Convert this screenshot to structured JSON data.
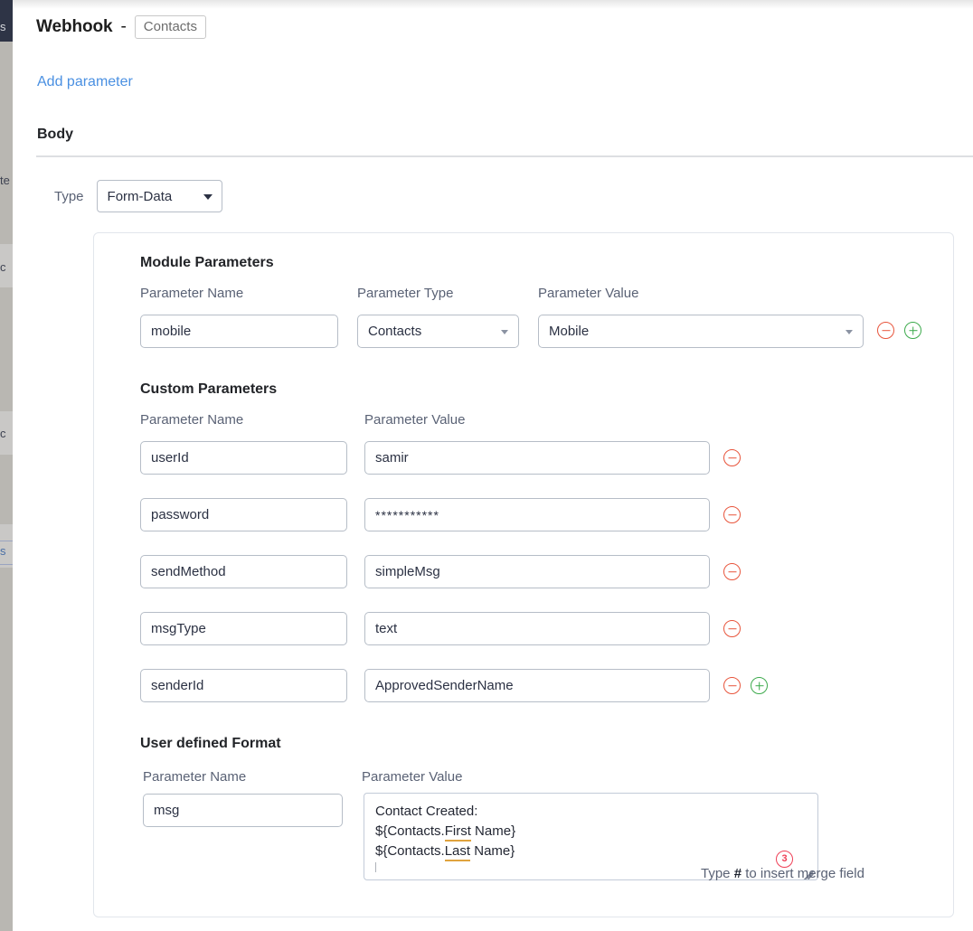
{
  "header": {
    "title": "Webhook",
    "separator": "-",
    "module_badge": "Contacts",
    "add_parameter_label": "Add parameter"
  },
  "body_section": {
    "heading": "Body",
    "type_label": "Type",
    "type_value": "Form-Data"
  },
  "module_parameters": {
    "title": "Module Parameters",
    "columns": {
      "name": "Parameter Name",
      "type": "Parameter Type",
      "value": "Parameter Value"
    },
    "rows": [
      {
        "name": "mobile",
        "type": "Contacts",
        "value": "Mobile"
      }
    ]
  },
  "custom_parameters": {
    "title": "Custom Parameters",
    "columns": {
      "name": "Parameter Name",
      "value": "Parameter Value"
    },
    "rows": [
      {
        "name": "userId",
        "value": "samir"
      },
      {
        "name": "password",
        "value": "***********"
      },
      {
        "name": "sendMethod",
        "value": "simpleMsg"
      },
      {
        "name": "msgType",
        "value": "text"
      },
      {
        "name": "senderId",
        "value": "ApprovedSenderName"
      }
    ]
  },
  "user_defined_format": {
    "title": "User defined Format",
    "columns": {
      "name": "Parameter Name",
      "value": "Parameter Value"
    },
    "name_value": "msg",
    "message_lines": {
      "line1": "Contact Created:",
      "line2_prefix": "${Contacts.",
      "line2_word": "First",
      "line2_suffix": " Name}",
      "line3_prefix": "${Contacts.",
      "line3_word": "Last",
      "line3_suffix": " Name}"
    },
    "merge_count_badge": "3",
    "merge_hint_prefix": "Type ",
    "merge_hint_symbol": "#",
    "merge_hint_suffix": " to insert merge field"
  },
  "background_panel": {
    "sliver_1": "s",
    "sliver_2": "te",
    "sliver_3": "c",
    "sliver_4": "c",
    "sliver_5": "s"
  },
  "colors": {
    "link": "#4a90e2",
    "remove": "#e8553c",
    "add": "#3caa4c",
    "badge": "#ef3f56",
    "label": "#5a6275",
    "spellcheck_underline": "#e0a33e"
  }
}
